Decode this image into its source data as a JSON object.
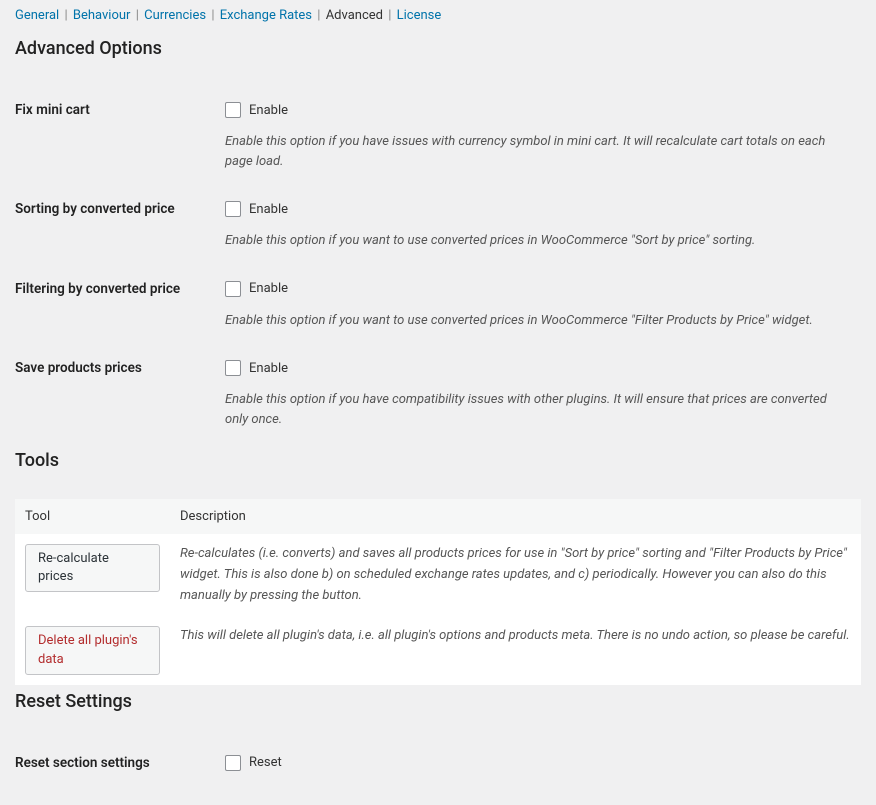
{
  "nav": {
    "items": [
      "General",
      "Behaviour",
      "Currencies",
      "Exchange Rates",
      "Advanced",
      "License"
    ],
    "active": "Advanced"
  },
  "heading": "Advanced Options",
  "options": {
    "fix_mini_cart": {
      "label": "Fix mini cart",
      "checkbox": "Enable",
      "desc": "Enable this option if you have issues with currency symbol in mini cart. It will recalculate cart totals on each page load."
    },
    "sort_converted": {
      "label": "Sorting by converted price",
      "checkbox": "Enable",
      "desc": "Enable this option if you want to use converted prices in WooCommerce \"Sort by price\" sorting."
    },
    "filter_converted": {
      "label": "Filtering by converted price",
      "checkbox": "Enable",
      "desc": "Enable this option if you want to use converted prices in WooCommerce \"Filter Products by Price\" widget."
    },
    "save_prices": {
      "label": "Save products prices",
      "checkbox": "Enable",
      "desc": "Enable this option if you have compatibility issues with other plugins. It will ensure that prices are converted only once."
    }
  },
  "tools": {
    "heading": "Tools",
    "headers": {
      "tool": "Tool",
      "desc": "Description"
    },
    "rows": [
      {
        "button": "Re-calculate prices",
        "desc": "Re-calculates (i.e. converts) and saves all products prices for use in \"Sort by price\" sorting and \"Filter Products by Price\" widget. This is also done b) on scheduled exchange rates updates, and c) periodically. However you can also do this manually by pressing the button."
      },
      {
        "button": "Delete all plugin's data",
        "desc": "This will delete all plugin's data, i.e. all plugin's options and products meta. There is no undo action, so please be careful."
      }
    ]
  },
  "reset": {
    "heading": "Reset Settings",
    "row_label": "Reset section settings",
    "checkbox": "Reset"
  }
}
